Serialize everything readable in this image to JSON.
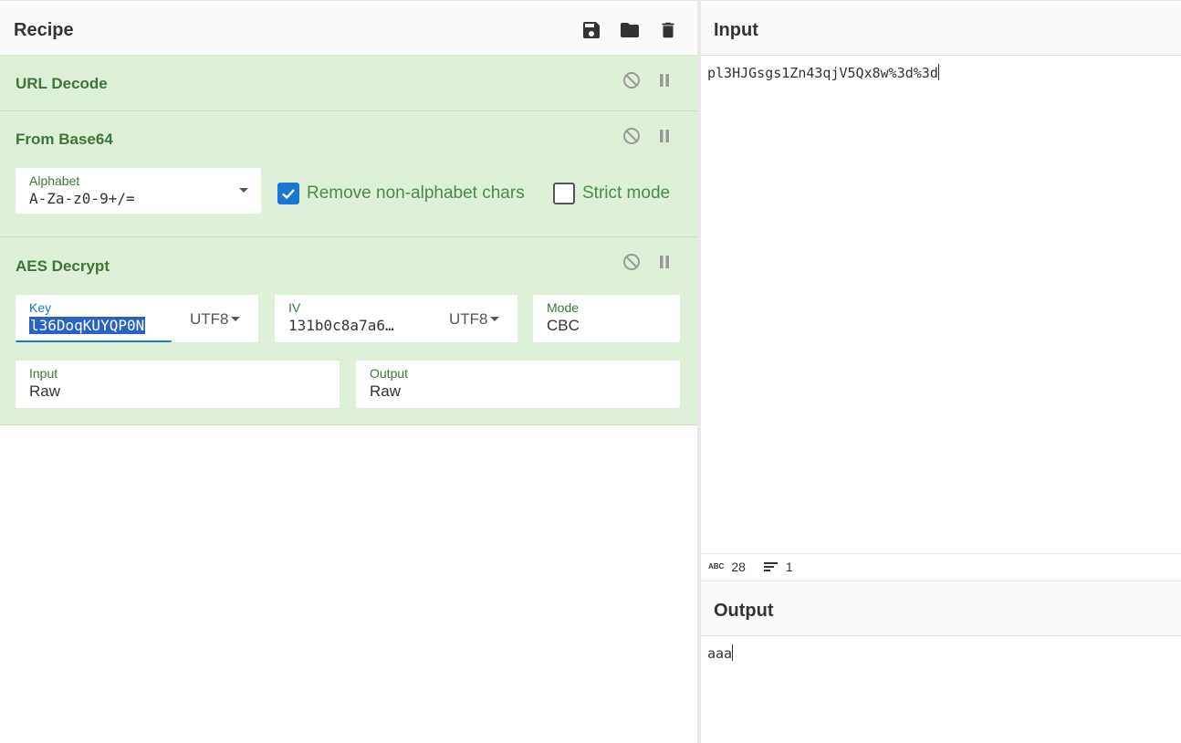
{
  "recipe": {
    "title": "Recipe",
    "header_icons": [
      "save-icon",
      "folder-icon",
      "trash-icon"
    ],
    "operations": [
      {
        "title": "URL Decode"
      },
      {
        "title": "From Base64",
        "alphabet_label": "Alphabet",
        "alphabet_value": "A-Za-z0-9+/=",
        "remove_nonalpha_label": "Remove non-alphabet chars",
        "remove_nonalpha_checked": true,
        "strict_mode_label": "Strict mode",
        "strict_mode_checked": false
      },
      {
        "title": "AES Decrypt",
        "key_label": "Key",
        "key_value": "l36DoqKUYQP0N",
        "key_encoding": "UTF8",
        "iv_label": "IV",
        "iv_value": "131b0c8a7a6…",
        "iv_encoding": "UTF8",
        "mode_label": "Mode",
        "mode_value": "CBC",
        "input_label": "Input",
        "input_value": "Raw",
        "output_label": "Output",
        "output_value": "Raw"
      }
    ]
  },
  "input": {
    "title": "Input",
    "text": "pl3HJGsgs1Zn43qjV5Qx8w%3d%3d",
    "char_count": "28",
    "line_count": "1"
  },
  "output": {
    "title": "Output",
    "text": "aaa"
  },
  "colors": {
    "op_bg": "#dff0d8",
    "op_title": "#3c763d",
    "checkbox_checked": "#1976d2",
    "selection": "#2962c7"
  }
}
